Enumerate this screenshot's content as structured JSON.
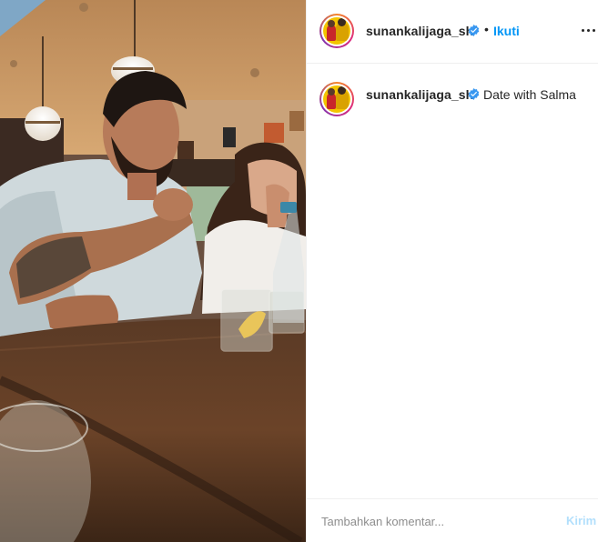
{
  "post": {
    "username": "sunankalijaga_sh",
    "follow_label": "Ikuti",
    "separator": "•",
    "caption": "Date with Salma"
  },
  "comment": {
    "placeholder": "Tambahkan komentar...",
    "post_label": "Kirim"
  },
  "icons": {
    "verified": "verified-badge-icon",
    "more": "more-options-icon"
  },
  "colors": {
    "accent": "#0095f6",
    "accent_disabled": "#b2dffc",
    "verified": "#3897f0",
    "text": "#262626",
    "muted": "#8e8e8e",
    "divider": "#efefef"
  }
}
